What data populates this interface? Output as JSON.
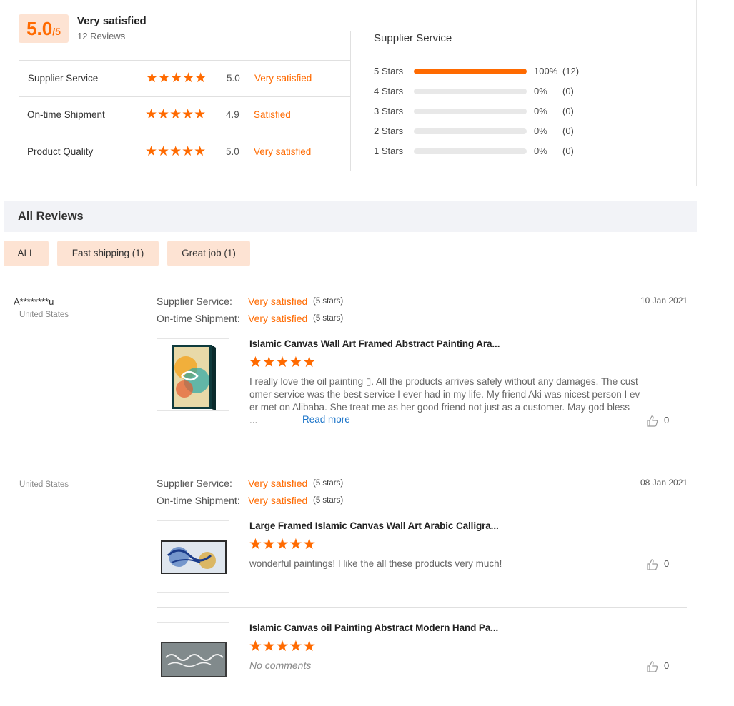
{
  "summary": {
    "score": "5.0",
    "score_max": "/5",
    "overall_label": "Very satisfied",
    "review_count": "12 Reviews",
    "metrics": [
      {
        "name": "Supplier Service",
        "stars": "★★★★★",
        "score": "5.0",
        "verdict": "Very satisfied",
        "active": true
      },
      {
        "name": "On-time Shipment",
        "stars": "★★★★★",
        "score": "4.9",
        "verdict": "Satisfied",
        "active": false
      },
      {
        "name": "Product Quality",
        "stars": "★★★★★",
        "score": "5.0",
        "verdict": "Very satisfied",
        "active": false
      }
    ]
  },
  "distribution": {
    "title": "Supplier Service",
    "rows": [
      {
        "label": "5  Stars",
        "percent": "100%",
        "fraction": 1.0,
        "count": "(12)"
      },
      {
        "label": "4  Stars",
        "percent": "0%",
        "fraction": 0,
        "count": "(0)"
      },
      {
        "label": "3  Stars",
        "percent": "0%",
        "fraction": 0,
        "count": "(0)"
      },
      {
        "label": "2  Stars",
        "percent": "0%",
        "fraction": 0,
        "count": "(0)"
      },
      {
        "label": "1  Stars",
        "percent": "0%",
        "fraction": 0,
        "count": "(0)"
      }
    ],
    "accent_color": "#ff6a00"
  },
  "all_reviews": {
    "title": "All Reviews",
    "tags": [
      "ALL",
      "Fast shipping (1)",
      "Great job (1)"
    ]
  },
  "reviews": [
    {
      "reviewer": "A********u",
      "country": "United States",
      "date": "10 Jan 2021",
      "supplier_label": "Supplier Service:",
      "supplier_verdict": "Very satisfied",
      "supplier_stars": "(5 stars)",
      "shipment_label": "On-time Shipment:",
      "shipment_verdict": "Very satisfied",
      "shipment_stars": "(5 stars)",
      "products": [
        {
          "title": "Islamic Canvas Wall Art Framed Abstract Painting Ara...",
          "stars": "★★★★★",
          "text_lines": [
            "I really love the oil painting ▯. All the products arrives safely without any damages. The cust",
            "omer service was the best service I ever had in my life. My friend Aki was nicest person I ev",
            "er met on Alibaba. She treat me as her good friend not just as a customer. May god bless"
          ],
          "ellipsis": "...",
          "read_more": "Read more",
          "likes": "0"
        }
      ]
    },
    {
      "reviewer": "",
      "country": "United States",
      "date": "08 Jan 2021",
      "supplier_label": "Supplier Service:",
      "supplier_verdict": "Very satisfied",
      "supplier_stars": "(5 stars)",
      "shipment_label": "On-time Shipment:",
      "shipment_verdict": "Very satisfied",
      "shipment_stars": "(5 stars)",
      "products": [
        {
          "title": "Large Framed Islamic Canvas Wall Art Arabic Calligra...",
          "stars": "★★★★★",
          "comment": "wonderful paintings! I like the all these products very much!",
          "likes": "0"
        },
        {
          "title": "Islamic Canvas oil Painting Abstract Modern Hand Pa...",
          "stars": "★★★★★",
          "comment": "No comments",
          "likes": "0"
        }
      ]
    }
  ]
}
